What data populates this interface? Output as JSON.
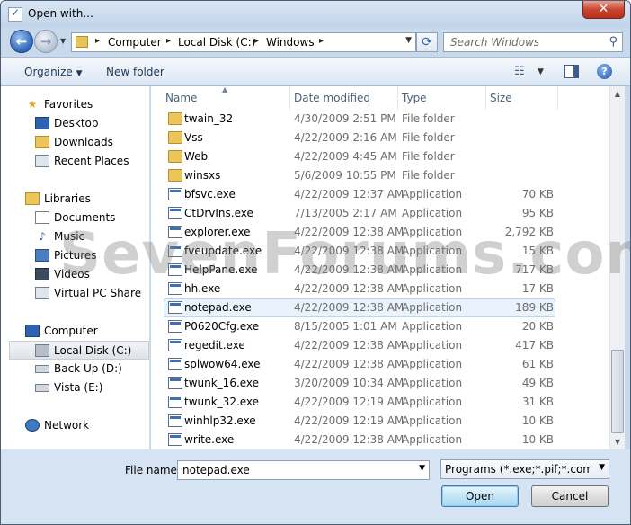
{
  "window": {
    "title": "Open with..."
  },
  "address": {
    "crumbs": [
      "Computer",
      "Local Disk (C:)",
      "Windows"
    ]
  },
  "search": {
    "placeholder": "Search Windows"
  },
  "toolbar": {
    "organize_label": "Organize",
    "new_folder_label": "New folder"
  },
  "nav": {
    "favorites_label": "Favorites",
    "favorites": [
      {
        "label": "Desktop",
        "icon": "desktop-icon"
      },
      {
        "label": "Downloads",
        "icon": "downloads-icon"
      },
      {
        "label": "Recent Places",
        "icon": "recent-places-icon"
      }
    ],
    "libraries_label": "Libraries",
    "libraries": [
      {
        "label": "Documents",
        "icon": "documents-icon"
      },
      {
        "label": "Music",
        "icon": "music-icon"
      },
      {
        "label": "Pictures",
        "icon": "pictures-icon"
      },
      {
        "label": "Videos",
        "icon": "videos-icon"
      },
      {
        "label": "Virtual PC Share",
        "icon": "share-icon"
      }
    ],
    "computer_label": "Computer",
    "drives": [
      {
        "label": "Local Disk (C:)",
        "selected": true
      },
      {
        "label": "Back Up (D:)",
        "selected": false
      },
      {
        "label": "Vista (E:)",
        "selected": false
      }
    ],
    "network_label": "Network"
  },
  "columns": {
    "name": "Name",
    "date": "Date modified",
    "type": "Type",
    "size": "Size"
  },
  "files": [
    {
      "name": "twain_32",
      "date": "4/30/2009 2:51 PM",
      "type": "File folder",
      "size": "",
      "kind": "folder"
    },
    {
      "name": "Vss",
      "date": "4/22/2009 2:16 AM",
      "type": "File folder",
      "size": "",
      "kind": "folder"
    },
    {
      "name": "Web",
      "date": "4/22/2009 4:45 AM",
      "type": "File folder",
      "size": "",
      "kind": "folder"
    },
    {
      "name": "winsxs",
      "date": "5/6/2009 10:55 PM",
      "type": "File folder",
      "size": "",
      "kind": "folder"
    },
    {
      "name": "bfsvc.exe",
      "date": "4/22/2009 12:37 AM",
      "type": "Application",
      "size": "70 KB",
      "kind": "app"
    },
    {
      "name": "CtDrvIns.exe",
      "date": "7/13/2005 2:17 AM",
      "type": "Application",
      "size": "95 KB",
      "kind": "app"
    },
    {
      "name": "explorer.exe",
      "date": "4/22/2009 12:38 AM",
      "type": "Application",
      "size": "2,792 KB",
      "kind": "app"
    },
    {
      "name": "fveupdate.exe",
      "date": "4/22/2009 12:38 AM",
      "type": "Application",
      "size": "15 KB",
      "kind": "app"
    },
    {
      "name": "HelpPane.exe",
      "date": "4/22/2009 12:38 AM",
      "type": "Application",
      "size": "717 KB",
      "kind": "app"
    },
    {
      "name": "hh.exe",
      "date": "4/22/2009 12:38 AM",
      "type": "Application",
      "size": "17 KB",
      "kind": "app"
    },
    {
      "name": "notepad.exe",
      "date": "4/22/2009 12:38 AM",
      "type": "Application",
      "size": "189 KB",
      "kind": "app",
      "selected": true
    },
    {
      "name": "P0620Cfg.exe",
      "date": "8/15/2005 1:01 AM",
      "type": "Application",
      "size": "20 KB",
      "kind": "app"
    },
    {
      "name": "regedit.exe",
      "date": "4/22/2009 12:38 AM",
      "type": "Application",
      "size": "417 KB",
      "kind": "app"
    },
    {
      "name": "splwow64.exe",
      "date": "4/22/2009 12:38 AM",
      "type": "Application",
      "size": "61 KB",
      "kind": "app"
    },
    {
      "name": "twunk_16.exe",
      "date": "3/20/2009 10:34 AM",
      "type": "Application",
      "size": "49 KB",
      "kind": "app"
    },
    {
      "name": "twunk_32.exe",
      "date": "4/22/2009 12:19 AM",
      "type": "Application",
      "size": "31 KB",
      "kind": "app"
    },
    {
      "name": "winhlp32.exe",
      "date": "4/22/2009 12:19 AM",
      "type": "Application",
      "size": "10 KB",
      "kind": "app"
    },
    {
      "name": "write.exe",
      "date": "4/22/2009 12:38 AM",
      "type": "Application",
      "size": "10 KB",
      "kind": "app"
    }
  ],
  "watermark": "SevenForums.com",
  "footer": {
    "file_name_label": "File name:",
    "file_name_value": "notepad.exe",
    "filter_value": "Programs (*.exe;*.pif;*.com;*.ba",
    "open_label": "Open",
    "cancel_label": "Cancel"
  }
}
